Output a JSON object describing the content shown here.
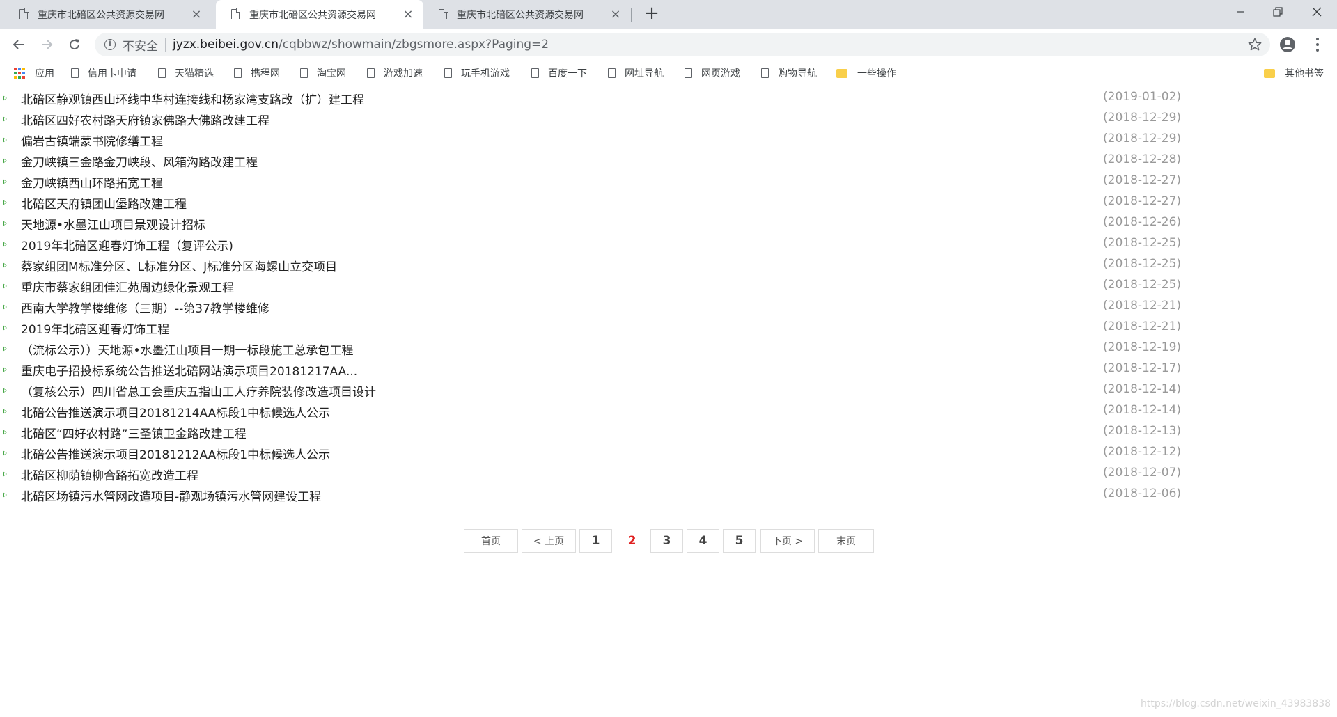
{
  "browser": {
    "tabs": [
      {
        "title": "重庆市北碚区公共资源交易网",
        "close": "×"
      },
      {
        "title": "重庆市北碚区公共资源交易网",
        "close": "×"
      },
      {
        "title": "重庆市北碚区公共资源交易网",
        "close": "×"
      }
    ],
    "active_tab_index": 1,
    "new_tab": "+",
    "address": {
      "security_label": "不安全",
      "host": "jyzx.beibei.gov.cn",
      "path": "/cqbbwz/showmain/zbgsmore.aspx?Paging=2"
    },
    "bookmarks": [
      {
        "label": "应用",
        "type": "apps"
      },
      {
        "label": "信用卡申请",
        "type": "page"
      },
      {
        "label": "天猫精选",
        "type": "page"
      },
      {
        "label": "携程网",
        "type": "page"
      },
      {
        "label": "淘宝网",
        "type": "page"
      },
      {
        "label": "游戏加速",
        "type": "page"
      },
      {
        "label": "玩手机游戏",
        "type": "page"
      },
      {
        "label": "百度一下",
        "type": "page"
      },
      {
        "label": "网址导航",
        "type": "page"
      },
      {
        "label": "网页游戏",
        "type": "page"
      },
      {
        "label": "购物导航",
        "type": "page"
      },
      {
        "label": "一些操作",
        "type": "folder"
      },
      {
        "label": "其他书签",
        "type": "folder"
      }
    ]
  },
  "announcements": [
    {
      "title": "北碚区静观镇西山环线中华村连接线和杨家湾支路改（扩）建工程",
      "date": "(2019-01-02)"
    },
    {
      "title": "北碚区四好农村路天府镇家佛路大佛路改建工程",
      "date": "(2018-12-29)"
    },
    {
      "title": "偏岩古镇端蒙书院修缮工程",
      "date": "(2018-12-29)"
    },
    {
      "title": "金刀峡镇三金路金刀峡段、风箱沟路改建工程",
      "date": "(2018-12-28)"
    },
    {
      "title": "金刀峡镇西山环路拓宽工程",
      "date": "(2018-12-27)"
    },
    {
      "title": "北碚区天府镇团山堡路改建工程",
      "date": "(2018-12-27)"
    },
    {
      "title": "天地源•水墨江山项目景观设计招标",
      "date": "(2018-12-26)"
    },
    {
      "title": "2019年北碚区迎春灯饰工程（复评公示)",
      "date": "(2018-12-25)"
    },
    {
      "title": "蔡家组团M标准分区、L标准分区、J标准分区海螺山立交项目",
      "date": "(2018-12-25)"
    },
    {
      "title": "重庆市蔡家组团佳汇苑周边绿化景观工程",
      "date": "(2018-12-25)"
    },
    {
      "title": "西南大学教学楼维修（三期）--第37教学楼维修",
      "date": "(2018-12-21)"
    },
    {
      "title": "2019年北碚区迎春灯饰工程",
      "date": "(2018-12-21)"
    },
    {
      "title": "（流标公示））天地源•水墨江山项目一期一标段施工总承包工程",
      "date": "(2018-12-19)"
    },
    {
      "title": "重庆电子招投标系统公告推送北碚网站演示项目20181217AA...",
      "date": "(2018-12-17)"
    },
    {
      "title": "（复核公示）四川省总工会重庆五指山工人疗养院装修改造项目设计",
      "date": "(2018-12-14)"
    },
    {
      "title": "北碚公告推送演示项目20181214AA标段1中标候选人公示",
      "date": "(2018-12-14)"
    },
    {
      "title": "北碚区“四好农村路”三圣镇卫金路改建工程",
      "date": "(2018-12-13)"
    },
    {
      "title": "北碚公告推送演示项目20181212AA标段1中标候选人公示",
      "date": "(2018-12-12)"
    },
    {
      "title": "北碚区柳荫镇柳合路拓宽改造工程",
      "date": "(2018-12-07)"
    },
    {
      "title": "北碚区场镇污水管网改造项目-静观场镇污水管网建设工程",
      "date": "(2018-12-06)"
    }
  ],
  "pagination": {
    "first": "首页",
    "prev": "< 上页",
    "pages": [
      "1",
      "2",
      "3",
      "4",
      "5"
    ],
    "current": "2",
    "next": "下页 >",
    "last": "末页"
  },
  "watermark": "https://blog.csdn.net/weixin_43983838",
  "colors": {
    "bullet": "#48a848",
    "current_page": "#e02020",
    "date": "#999999",
    "link": "#222222"
  }
}
